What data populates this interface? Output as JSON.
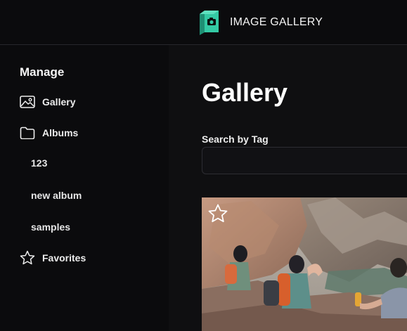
{
  "header": {
    "title": "IMAGE GALLERY",
    "logo_icon": "camera-box-icon",
    "accent": "#34c9a4"
  },
  "sidebar": {
    "heading": "Manage",
    "items": [
      {
        "label": "Gallery",
        "icon": "image-icon"
      },
      {
        "label": "Albums",
        "icon": "folder-icon"
      },
      {
        "label": "Favorites",
        "icon": "star-icon"
      }
    ],
    "albums": [
      "123",
      "new album",
      "samples"
    ]
  },
  "main": {
    "title": "Gallery",
    "search": {
      "label": "Search by Tag",
      "value": "",
      "placeholder": ""
    },
    "photos": [
      {
        "alt": "hikers resting on canyon rocks",
        "favorite": false,
        "fav_icon": "star-outline-icon"
      }
    ]
  }
}
